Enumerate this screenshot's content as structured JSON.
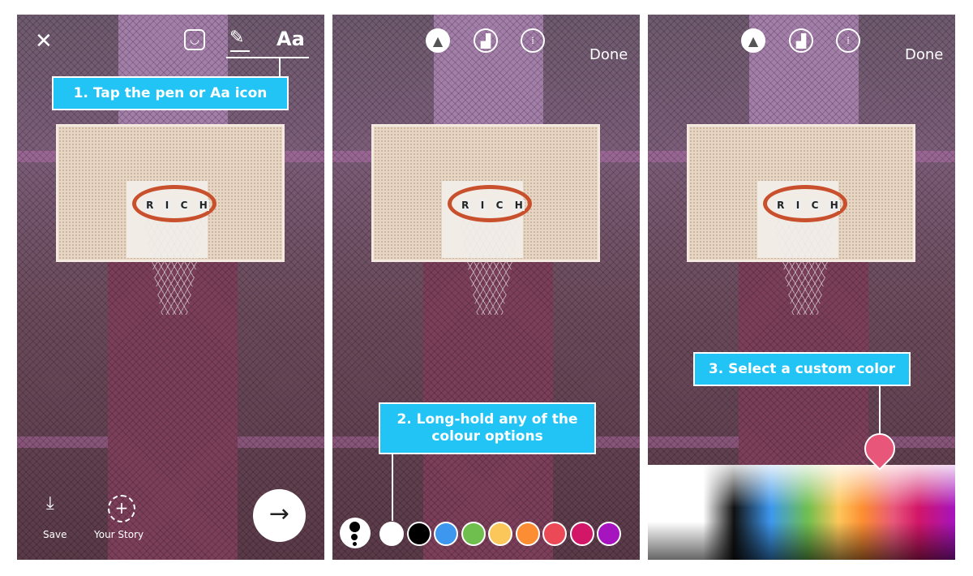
{
  "panel1": {
    "close_icon": "close-icon",
    "sticker_icon": "sticker-icon",
    "pen_icon": "pen-icon",
    "text_tool": "Aa",
    "callout": "1. Tap the pen or Aa icon",
    "save_label": "Save",
    "story_label": "Your Story",
    "next_icon": "arrow-right-icon"
  },
  "panel2": {
    "tools": [
      "marker-icon",
      "highlighter-icon",
      "neon-icon"
    ],
    "done": "Done",
    "callout": "2. Long-hold any of the colour options",
    "colors": [
      "#ffffff",
      "#000000",
      "#3d97ee",
      "#6fbf4f",
      "#fcc75a",
      "#fc8d32",
      "#eb4956",
      "#d21668",
      "#a514be"
    ],
    "pages": 3,
    "active_page": 1
  },
  "panel3": {
    "tools": [
      "marker-icon",
      "highlighter-icon",
      "neon-icon"
    ],
    "done": "Done",
    "callout": "3. Select a custom color",
    "selected_color": "#e8577a"
  },
  "accent": "#22c4f6"
}
